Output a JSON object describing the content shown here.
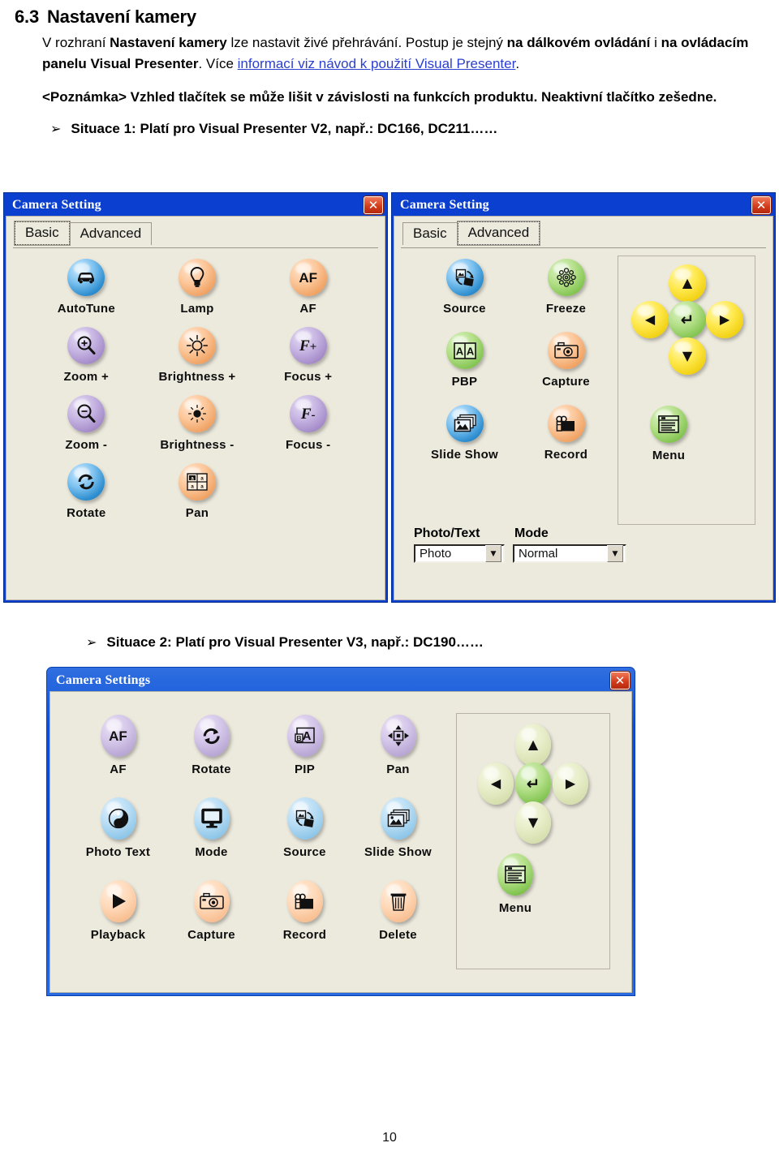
{
  "document": {
    "section_number": "6.3",
    "section_title": "Nastavení kamery",
    "paragraph": {
      "p1": "V rozhraní ",
      "b1": "Nastavení kamery",
      "p2": " lze nastavit živé přehrávání. ",
      "p3": "Postup je stejný ",
      "b2": "na dálkovém ovládání",
      "p4": " i ",
      "b3": "na ovládacím panelu Visual Presenter",
      "p5": ". Více ",
      "link": "informací viz návod k použití Visual Presenter",
      "p6": "."
    },
    "note": "<Poznámka> Vzhled tlačítek se může lišit v závislosti na funkcích produktu. Neaktivní tlačítko zešedne.",
    "bullet_glyph": "➢",
    "bullet1": "Situace 1: Platí pro Visual Presenter V2, např.: DC166, DC211……",
    "bullet2": "Situace 2: Platí pro Visual Presenter V3, např.: DC190……",
    "page_number": "10"
  },
  "dialog_basic": {
    "title": "Camera Setting",
    "close_glyph": "✕",
    "tabs": [
      {
        "label": "Basic",
        "selected": true
      },
      {
        "label": "Advanced",
        "selected": false
      }
    ],
    "buttons": [
      {
        "label": "AutoTune",
        "icon": "car-icon",
        "color": "#3f9ad6"
      },
      {
        "label": "Lamp",
        "icon": "lightbulb-icon",
        "color": "#f2a964"
      },
      {
        "label": "AF",
        "icon": "af-text-icon",
        "color": "#f2a964"
      },
      {
        "label": "Zoom +",
        "icon": "zoom-in-icon",
        "color": "#a98fcb"
      },
      {
        "label": "Brightness +",
        "icon": "sun-bright-icon",
        "color": "#f2a964"
      },
      {
        "label": "Focus +",
        "icon": "focus-plus-icon",
        "color": "#a98fcb"
      },
      {
        "label": "Zoom -",
        "icon": "zoom-out-icon",
        "color": "#a98fcb"
      },
      {
        "label": "Brightness -",
        "icon": "sun-dim-icon",
        "color": "#f2a964"
      },
      {
        "label": "Focus -",
        "icon": "focus-minus-icon",
        "color": "#a98fcb"
      },
      {
        "label": "Rotate",
        "icon": "rotate-icon",
        "color": "#3f9ad6"
      },
      {
        "label": "Pan",
        "icon": "pan-grid-icon",
        "color": "#f2a964"
      }
    ]
  },
  "dialog_advanced": {
    "title": "Camera Setting",
    "close_glyph": "✕",
    "tabs": [
      {
        "label": "Basic",
        "selected": false
      },
      {
        "label": "Advanced",
        "selected": true
      }
    ],
    "buttons": [
      {
        "label": "Source",
        "icon": "source-swap-icon",
        "color": "#3f9ad6"
      },
      {
        "label": "Freeze",
        "icon": "snowflake-icon",
        "color": "#84c553"
      },
      {
        "label": "PBP",
        "icon": "pbp-aa-icon",
        "color": "#84c553"
      },
      {
        "label": "Capture",
        "icon": "camera-icon",
        "color": "#f2a964"
      },
      {
        "label": "Slide Show",
        "icon": "slideshow-icon",
        "color": "#3f9ad6"
      },
      {
        "label": "Record",
        "icon": "camcorder-icon",
        "color": "#f2a964"
      }
    ],
    "dpad": {
      "up": "▲",
      "down": "▼",
      "left": "◀",
      "right": "▶",
      "enter": "↵",
      "arrow_color": "#f2d215",
      "enter_color": "#84c553"
    },
    "menu": {
      "label": "Menu",
      "icon": "menu-list-icon",
      "color": "#84c553"
    },
    "combos": [
      {
        "label": "Photo/Text",
        "value": "Photo",
        "arrow": "▼"
      },
      {
        "label": "Mode",
        "value": "Normal",
        "arrow": "▼"
      }
    ]
  },
  "dialog_v3": {
    "title": "Camera Settings",
    "close_glyph": "✕",
    "buttons": [
      {
        "label": "AF",
        "icon": "af-text-icon",
        "color": "#b8a6d4"
      },
      {
        "label": "Rotate",
        "icon": "rotate-icon",
        "color": "#b8a6d4"
      },
      {
        "label": "PIP",
        "icon": "pip-ab-icon",
        "color": "#b8a6d4"
      },
      {
        "label": "Pan",
        "icon": "pan-move-icon",
        "color": "#b8a6d4"
      },
      {
        "label": "Photo Text",
        "icon": "photo-text-icon",
        "color": "#8ec6e8"
      },
      {
        "label": "Mode",
        "icon": "monitor-icon",
        "color": "#8ec6e8"
      },
      {
        "label": "Source",
        "icon": "source-swap-icon",
        "color": "#8ec6e8"
      },
      {
        "label": "Slide Show",
        "icon": "slideshow-icon",
        "color": "#8ec6e8"
      },
      {
        "label": "Playback",
        "icon": "play-icon",
        "color": "#f8bf92"
      },
      {
        "label": "Capture",
        "icon": "camera-icon",
        "color": "#f8bf92"
      },
      {
        "label": "Record",
        "icon": "camcorder-icon",
        "color": "#f8bf92"
      },
      {
        "label": "Delete",
        "icon": "trash-icon",
        "color": "#f8bf92"
      }
    ],
    "dpad": {
      "up": "▲",
      "down": "▼",
      "left": "◀",
      "right": "▶",
      "enter": "↵",
      "arrow_color": "#e7edc8",
      "enter_color": "#84c553"
    },
    "menu": {
      "label": "Menu",
      "icon": "menu-list-icon",
      "color": "#84c553"
    }
  }
}
